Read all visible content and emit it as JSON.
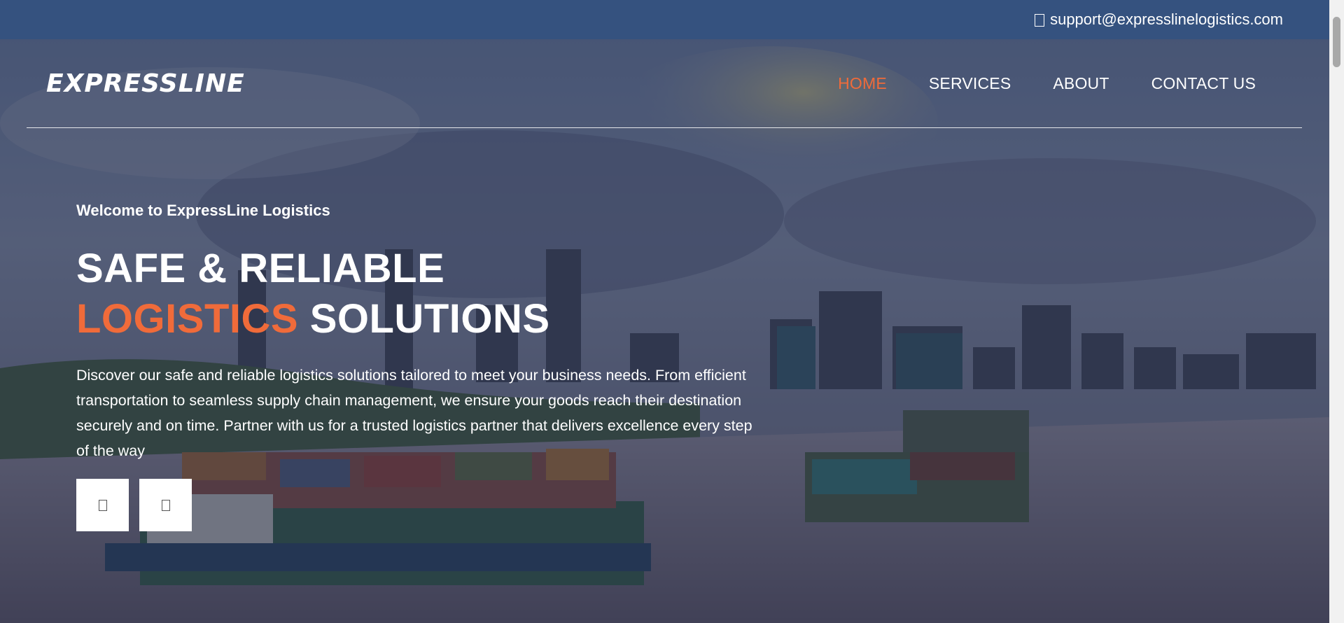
{
  "topbar": {
    "email": "support@expresslinelogistics.com",
    "email_icon": "mail-icon"
  },
  "header": {
    "logo_text": "EXPRESSLINE",
    "nav": [
      {
        "label": "HOME",
        "active": true
      },
      {
        "label": "SERVICES",
        "active": false
      },
      {
        "label": "ABOUT",
        "active": false
      },
      {
        "label": "CONTACT US",
        "active": false
      }
    ]
  },
  "hero": {
    "welcome": "Welcome to ExpressLine Logistics",
    "headline_line1": "SAFE & RELIABLE",
    "headline_accent": "LOGISTICS",
    "headline_rest": "SOLUTIONS",
    "description": "Discover our safe and reliable logistics solutions tailored to meet your business needs. From efficient transportation to seamless supply chain management, we ensure your goods reach their destination securely and on time. Partner with us for a trusted logistics partner that delivers excellence every step of the way",
    "prev_icon": "chevron-left-icon",
    "next_icon": "chevron-right-icon"
  },
  "colors": {
    "topbar_bg": "#35527f",
    "accent": "#f06b3a",
    "text": "#ffffff"
  }
}
